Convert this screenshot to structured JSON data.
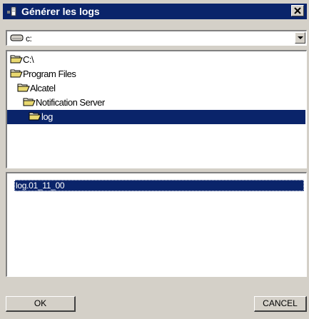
{
  "window": {
    "title": "Générer les logs",
    "title_bar_color": "#0a246a",
    "close_label": "close"
  },
  "drive": {
    "selected": "c:",
    "icon": "drive-icon"
  },
  "tree": {
    "items": [
      {
        "label": "C:\\",
        "icon": "open-folder-icon",
        "selected": false
      },
      {
        "label": "Program Files",
        "icon": "open-folder-icon",
        "selected": false
      },
      {
        "label": "Alcatel",
        "icon": "open-folder-icon",
        "selected": false
      },
      {
        "label": "Notification Server",
        "icon": "open-folder-icon",
        "selected": false
      },
      {
        "label": "log",
        "icon": "open-folder-icon",
        "selected": true
      }
    ],
    "selection_color": "#0a246a"
  },
  "files": {
    "items": [
      {
        "label": "log.01_11_00",
        "selected": true
      }
    ]
  },
  "buttons": {
    "ok_label": "OK",
    "cancel_label": "CANCEL"
  }
}
